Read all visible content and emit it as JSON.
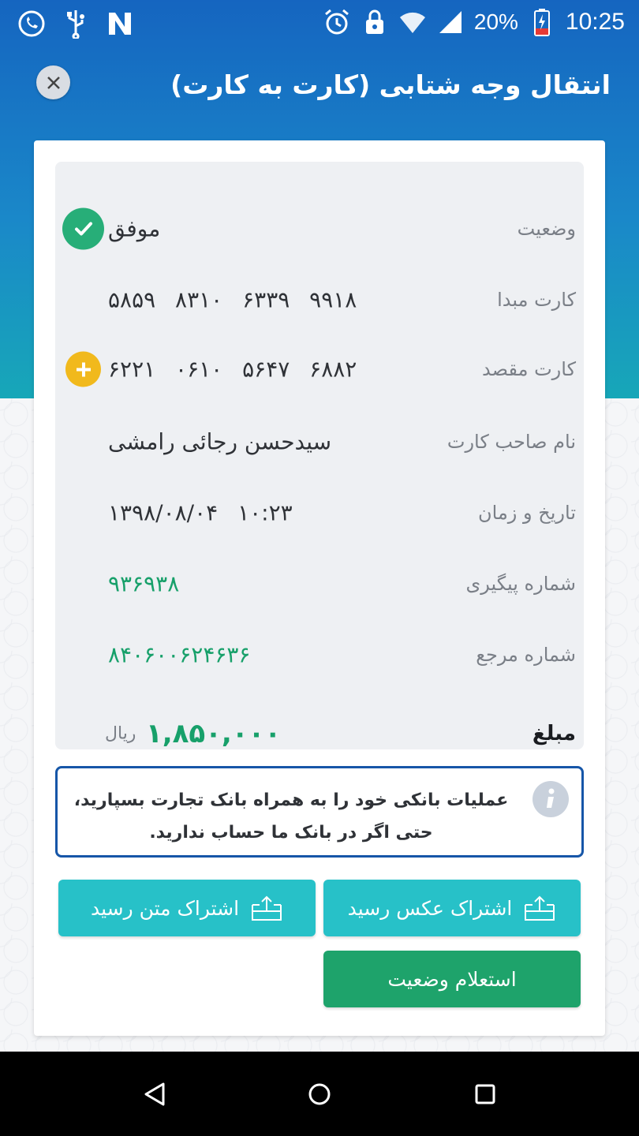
{
  "status_bar": {
    "battery": "20%",
    "time": "10:25",
    "icons": [
      "whatsapp-icon",
      "usb-icon",
      "n-app-icon",
      "alarm-icon",
      "lock-icon",
      "wifi-icon",
      "signal-icon",
      "battery-charging-icon"
    ]
  },
  "header": {
    "title": "انتقال وجه شتابی (کارت به کارت)",
    "close_icon": "close-icon"
  },
  "receipt": {
    "status": {
      "label": "وضعیت",
      "value": "موفق",
      "icon": "check-circle-icon"
    },
    "source_card": {
      "label": "کارت مبدا",
      "value": "۵۸۵۹ ۸۳۱۰ ۶۳۳۹ ۹۹۱۸"
    },
    "dest_card": {
      "label": "کارت مقصد",
      "value": "۶۲۲۱ ۰۶۱۰ ۵۶۴۷ ۶۸۸۲",
      "icon": "add-circle-icon"
    },
    "holder": {
      "label": "نام صاحب کارت",
      "value": "سیدحسن رجائی رامشی"
    },
    "datetime": {
      "label": "تاریخ و زمان",
      "value": "۱۳۹۸/۰۸/۰۴ ۱۰:۲۳"
    },
    "tracking": {
      "label": "شماره پیگیری",
      "value": "۹۳۶۹۳۸"
    },
    "reference": {
      "label": "شماره مرجع",
      "value": "۸۴۰۶۰۰۶۲۴۶۳۶"
    },
    "amount": {
      "label": "مبلغ",
      "value": "۱,۸۵۰,۰۰۰",
      "unit": "ریال"
    }
  },
  "info": {
    "line1": "عملیات بانکی خود را به همراه بانک تجارت بسپارید،",
    "line2": "حتی اگر در بانک ما حساب ندارید.",
    "icon": "info-icon"
  },
  "buttons": {
    "share_image": "اشتراک عکس رسید",
    "share_text": "اشتراک متن رسید",
    "inquiry": "استعلام وضعیت"
  },
  "colors": {
    "header_blue": "#1565c0",
    "success_green": "#27ae78",
    "share_cyan": "#27c1c8",
    "inquiry_green": "#1ea36b",
    "warning_yellow": "#f1b91c"
  }
}
